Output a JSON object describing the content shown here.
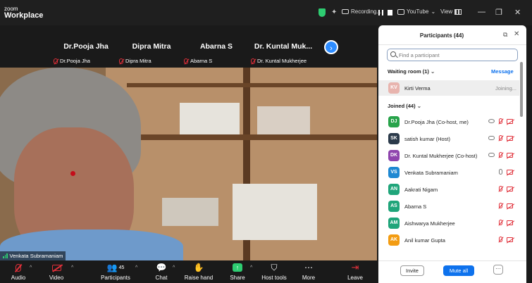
{
  "titlebar": {
    "logo_top": "zoom",
    "logo_bottom": "Workplace",
    "recording_label": "Recording...",
    "youtube_label": "YouTube",
    "view_label": "View",
    "minimize": "—",
    "restore": "❐",
    "close": "✕"
  },
  "strip": {
    "tiles": [
      {
        "name": "Dr.Pooja Jha",
        "label": "Dr.Pooja Jha"
      },
      {
        "name": "Dipra Mitra",
        "label": "Dipra Mitra"
      },
      {
        "name": "Abarna S",
        "label": "Abarna S"
      },
      {
        "name": "Dr. Kuntal  Muk...",
        "label": "Dr. Kuntal Mukherjee"
      }
    ],
    "next_icon": "›"
  },
  "video": {
    "speaker_label": "Venkata Subramaniam"
  },
  "toolbar": {
    "audio": "Audio",
    "video": "Video",
    "participants": "Participants",
    "participants_count": "45",
    "chat": "Chat",
    "raise_hand": "Raise hand",
    "share": "Share",
    "host_tools": "Host tools",
    "more": "More",
    "leave": "Leave"
  },
  "panel": {
    "title": "Participants (44)",
    "search_placeholder": "Find a participant",
    "waiting_header": "Waiting room (1)",
    "message_link": "Message",
    "waiting": [
      {
        "initials": "KV",
        "name": "Kirti Verma",
        "status": "Joining...",
        "color": "#e8b4ae"
      }
    ],
    "joined_header": "Joined (44)",
    "joined": [
      {
        "initials": "DJ",
        "name": "Dr.Pooja Jha (Co-host, me)",
        "color": "#27a34a"
      },
      {
        "initials": "SK",
        "name": "satish kumar (Host)",
        "color": "#2b3a4a"
      },
      {
        "initials": "DK",
        "name": "Dr. Kuntal Mukherjee (Co-host)",
        "color": "#8e44ad"
      },
      {
        "initials": "VS",
        "name": "Venkata Subramaniam",
        "color": "#1e88d2"
      },
      {
        "initials": "AN",
        "name": "Aakrati Nigam",
        "color": "#1fa57a"
      },
      {
        "initials": "AS",
        "name": "Abarna S",
        "color": "#1fa57a"
      },
      {
        "initials": "AM",
        "name": "Aishwarya Mukherjee",
        "color": "#1fa57a"
      },
      {
        "initials": "AK",
        "name": "Anil kumar Gupta",
        "color": "#f39c12"
      }
    ],
    "invite": "Invite",
    "mute_all": "Mute all",
    "more": "···"
  }
}
